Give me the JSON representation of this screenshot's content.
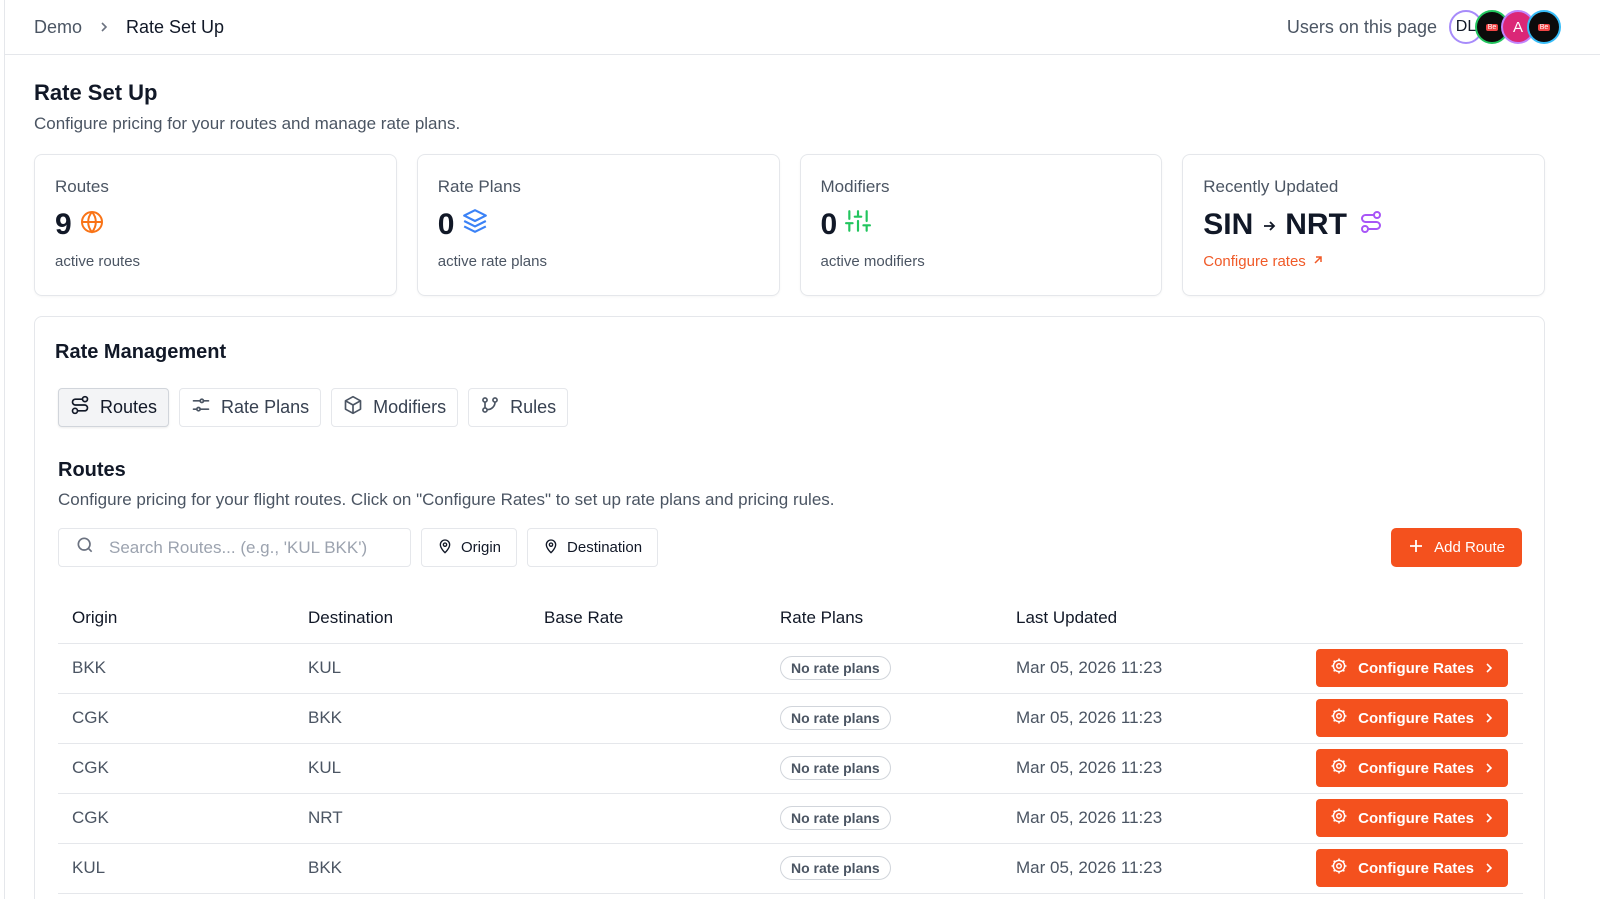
{
  "breadcrumb": {
    "parent": "Demo",
    "current": "Rate Set Up"
  },
  "presence": {
    "label": "Users on this page",
    "avatars": [
      "DL",
      "",
      "A",
      ""
    ]
  },
  "page": {
    "title": "Rate Set Up",
    "subtitle": "Configure pricing for your routes and manage rate plans."
  },
  "stats": [
    {
      "title": "Routes",
      "value": "9",
      "sub": "active routes",
      "icon": "globe-icon",
      "color": "#f97316"
    },
    {
      "title": "Rate Plans",
      "value": "0",
      "sub": "active rate plans",
      "icon": "layers-icon",
      "color": "#3b82f6"
    },
    {
      "title": "Modifiers",
      "value": "0",
      "sub": "active modifiers",
      "icon": "sliders-icon",
      "color": "#22c55e"
    },
    {
      "title": "Recently Updated",
      "from": "SIN",
      "to": "NRT",
      "link": "Configure rates",
      "icon": "route-icon",
      "color": "#a855f7"
    }
  ],
  "management": {
    "title": "Rate Management",
    "tabs": [
      {
        "label": "Routes",
        "icon": "route-icon",
        "active": true
      },
      {
        "label": "Rate Plans",
        "icon": "sliders-horizontal-icon",
        "active": false
      },
      {
        "label": "Modifiers",
        "icon": "package-icon",
        "active": false
      },
      {
        "label": "Rules",
        "icon": "git-branch-icon",
        "active": false
      }
    ]
  },
  "routes_section": {
    "title": "Routes",
    "description": "Configure pricing for your flight routes. Click on \"Configure Rates\" to set up rate plans and pricing rules.",
    "search_placeholder": "Search Routes... (e.g., 'KUL BKK')",
    "filter_origin": "Origin",
    "filter_destination": "Destination",
    "add_button": "Add Route"
  },
  "table": {
    "columns": [
      "Origin",
      "Destination",
      "Base Rate",
      "Rate Plans",
      "Last Updated"
    ],
    "rows": [
      {
        "origin": "BKK",
        "destination": "KUL",
        "base_rate": "",
        "rate_plans": "No rate plans",
        "updated": "Mar 05, 2026 11:23",
        "action": "Configure Rates"
      },
      {
        "origin": "CGK",
        "destination": "BKK",
        "base_rate": "",
        "rate_plans": "No rate plans",
        "updated": "Mar 05, 2026 11:23",
        "action": "Configure Rates"
      },
      {
        "origin": "CGK",
        "destination": "KUL",
        "base_rate": "",
        "rate_plans": "No rate plans",
        "updated": "Mar 05, 2026 11:23",
        "action": "Configure Rates"
      },
      {
        "origin": "CGK",
        "destination": "NRT",
        "base_rate": "",
        "rate_plans": "No rate plans",
        "updated": "Mar 05, 2026 11:23",
        "action": "Configure Rates"
      },
      {
        "origin": "KUL",
        "destination": "BKK",
        "base_rate": "",
        "rate_plans": "No rate plans",
        "updated": "Mar 05, 2026 11:23",
        "action": "Configure Rates"
      }
    ]
  },
  "colors": {
    "accent": "#f4511e",
    "border": "#e5e7eb",
    "muted_text": "#4b5563"
  }
}
